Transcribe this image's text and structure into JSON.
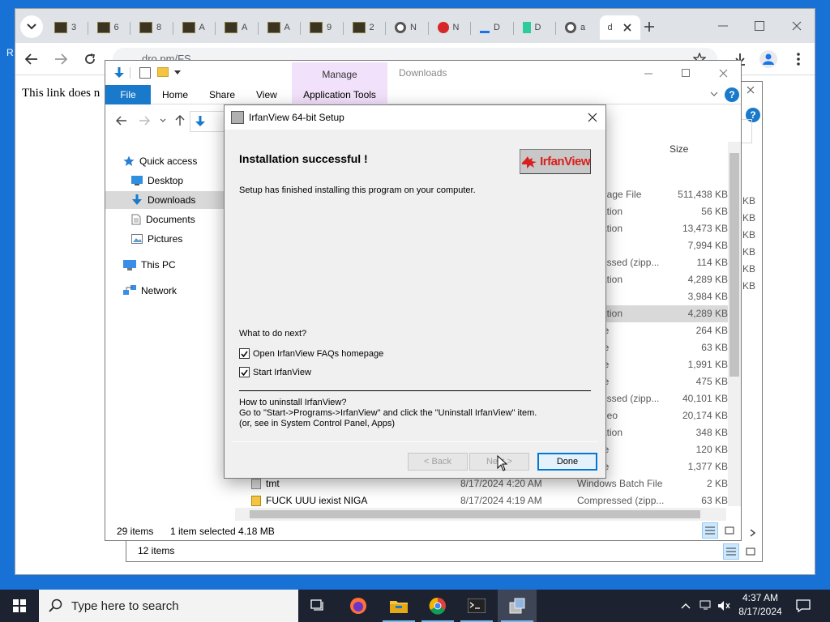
{
  "browser": {
    "tabs": [
      {
        "label": "3"
      },
      {
        "label": "6"
      },
      {
        "label": "8"
      },
      {
        "label": "A"
      },
      {
        "label": "A"
      },
      {
        "label": "A"
      },
      {
        "label": "9"
      },
      {
        "label": "2"
      },
      {
        "label": "N"
      },
      {
        "label": "N"
      },
      {
        "label": "D"
      },
      {
        "label": "D"
      },
      {
        "label": "a"
      },
      {
        "label": "d"
      }
    ],
    "address": "dro.pm/FS",
    "page_text": "This link does n",
    "left_edge_text": "R"
  },
  "explorer_back": {
    "status_items": "12 items"
  },
  "explorer": {
    "title": "Downloads",
    "ribbon": {
      "manage_label": "Manage",
      "file_label": "File",
      "home_label": "Home",
      "share_label": "Share",
      "view_label": "View",
      "app_tools_label": "Application Tools"
    },
    "nav": {
      "quick_access": "Quick access",
      "desktop": "Desktop",
      "downloads": "Downloads",
      "documents": "Documents",
      "pictures": "Pictures",
      "this_pc": "This PC",
      "network": "Network"
    },
    "size_header": "Size",
    "files": [
      {
        "type": "nage File",
        "size": "511,438 KB"
      },
      {
        "type": "ation",
        "size": "56 KB"
      },
      {
        "type": "ation",
        "size": "13,473 KB"
      },
      {
        "type": "",
        "size": "7,994 KB"
      },
      {
        "type": "essed (zipp...",
        "size": "114 KB"
      },
      {
        "type": "ation",
        "size": "4,289 KB"
      },
      {
        "type": "",
        "size": "3,984 KB"
      },
      {
        "type": "ation",
        "size": "4,289 KB"
      },
      {
        "type": "le",
        "size": "264 KB"
      },
      {
        "type": "le",
        "size": "63 KB"
      },
      {
        "type": "le",
        "size": "1,991 KB"
      },
      {
        "type": "le",
        "size": "475 KB"
      },
      {
        "type": "essed (zipp...",
        "size": "40,101 KB"
      },
      {
        "type": "deo",
        "size": "20,174 KB"
      },
      {
        "type": "ation",
        "size": "348 KB"
      },
      {
        "type": "le",
        "size": "120 KB"
      },
      {
        "type": "le",
        "size": "1,377 KB"
      }
    ],
    "bottom_files": [
      {
        "name": "tmt",
        "date": "8/17/2024 4:20 AM",
        "type": "Windows Batch File",
        "size": "2 KB"
      },
      {
        "name": "FUCK UUU iexist NIGA",
        "date": "8/17/2024 4:19 AM",
        "type": "Compressed (zipp...",
        "size": "63 KB"
      }
    ],
    "status_items": "29 items",
    "status_selected": "1 item selected  4.18 MB",
    "right_overflow_labels": [
      "KB",
      "KB",
      "KB",
      "KB",
      "KB",
      "KB"
    ]
  },
  "dialog": {
    "title": "IrfanView 64-bit Setup",
    "heading": "Installation successful !",
    "description": "Setup has finished installing this program on your computer.",
    "logo_text": "IrfanView",
    "what_next": "What to do next?",
    "option_faq": "Open IrfanView FAQs homepage",
    "option_start": "Start IrfanView",
    "uninstall_line1": "How to uninstall IrfanView?",
    "uninstall_line2": "Go to \"Start->Programs->IrfanView\" and click the \"Uninstall IrfanView\" item.",
    "uninstall_line3": "(or, see in System Control Panel, Apps)",
    "back_label": "< Back",
    "next_label": "Next >",
    "done_label": "Done"
  },
  "taskbar": {
    "search_placeholder": "Type here to search",
    "time": "4:37 AM",
    "date": "8/17/2024"
  }
}
